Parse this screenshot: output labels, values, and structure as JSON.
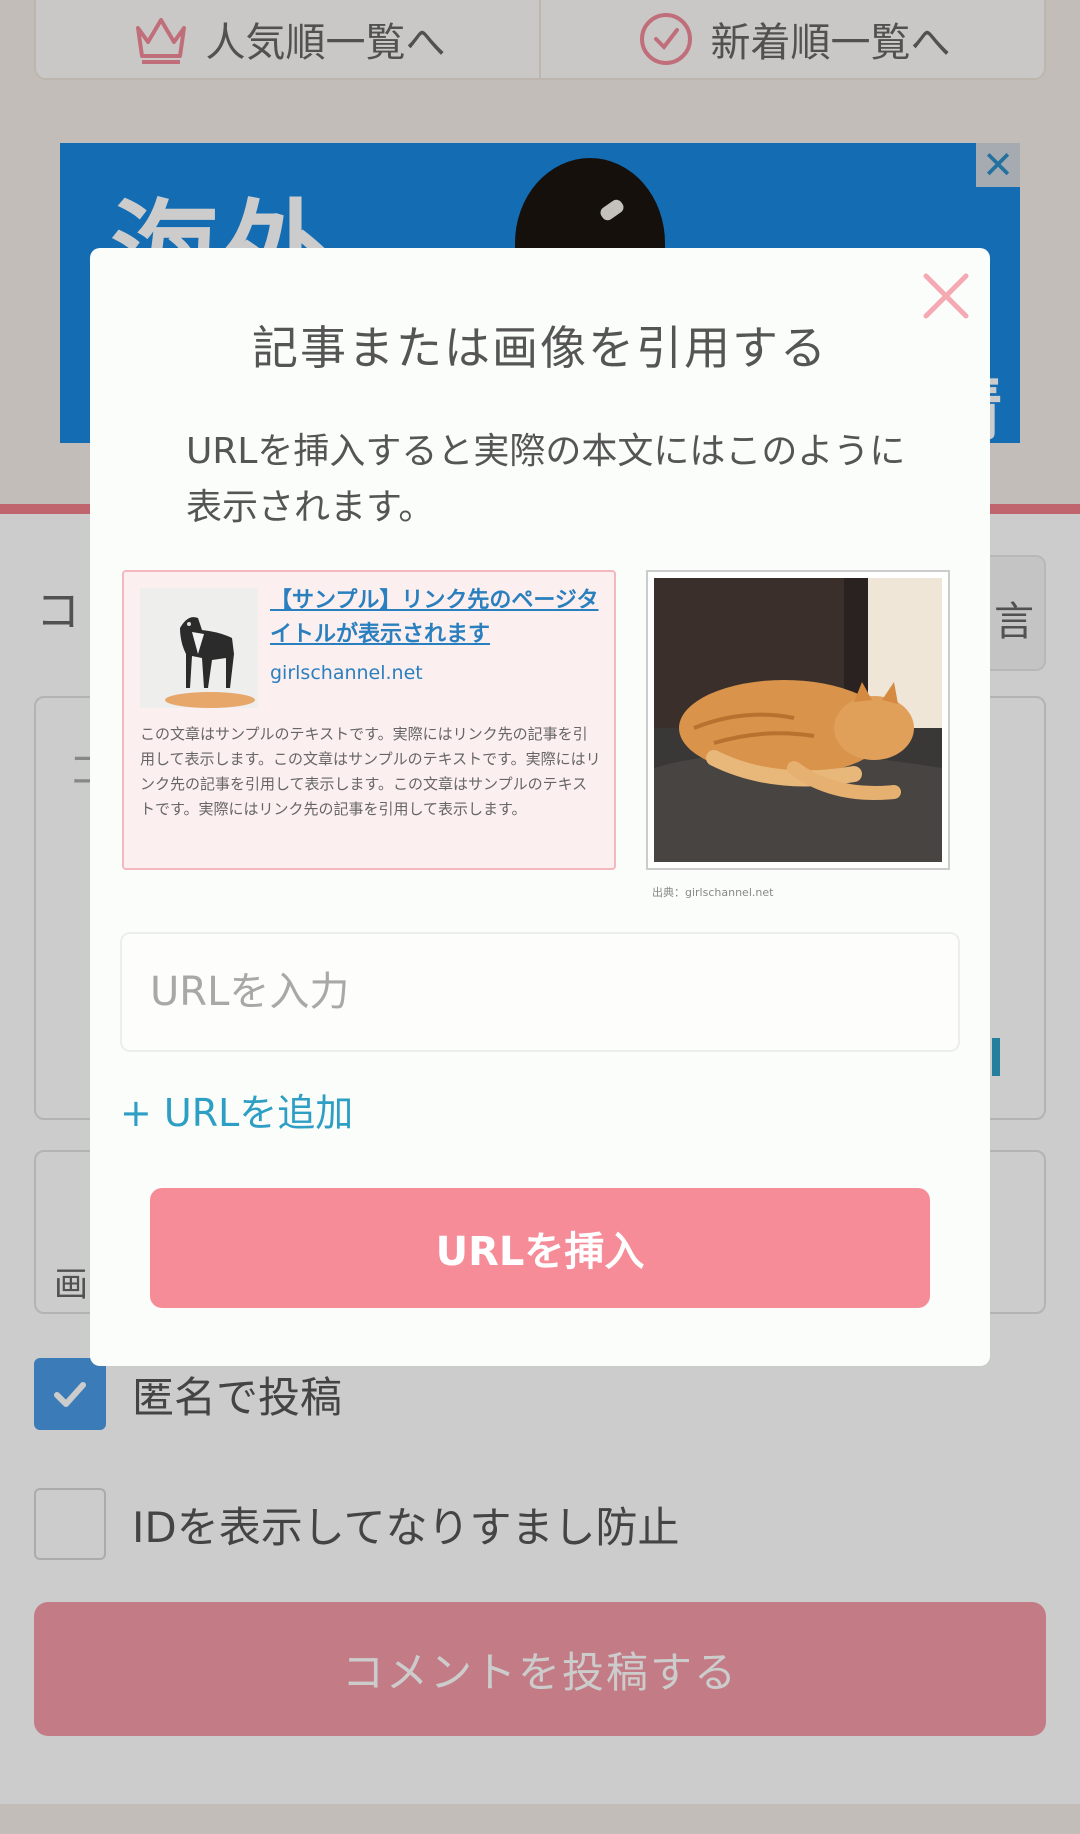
{
  "top_nav": {
    "popular_label": "人気順一覧へ",
    "popular_icon": "crown-icon",
    "newest_label": "新着順一覧へ",
    "newest_icon": "clock-check-icon"
  },
  "ad": {
    "headline": "海外",
    "right_text": "情",
    "close_icon": "close-icon",
    "close_glyph": "✕"
  },
  "form": {
    "left_label_fragment": "コ",
    "right_box_fragment": "言",
    "textarea_fragment": "コ",
    "image_label_fragment": "画",
    "anonymous_label": "匿名で投稿",
    "anonymous_checked": true,
    "show_id_label": "IDを表示してなりすまし防止",
    "show_id_checked": false,
    "submit_label": "コメントを投稿する"
  },
  "modal": {
    "title": "記事または画像を引用する",
    "description": "URLを挿入すると実際の本文にはこのように表示されます。",
    "close_icon": "close-x-icon",
    "sample_link": {
      "title": "【サンプル】リンク先のページタイトルが表示されます",
      "domain": "girlschannel.net",
      "body": "この文章はサンプルのテキストです。実際にはリンク先の記事を引用して表示します。この文章はサンプルのテキストです。実際にはリンク先の記事を引用して表示します。この文章はサンプルのテキストです。実際にはリンク先の記事を引用して表示します。"
    },
    "sample_photo": {
      "caption": "出典：girlschannel.net"
    },
    "url_input_placeholder": "URLを入力",
    "url_input_value": "",
    "add_url_label": "+ URLを追加",
    "insert_button_label": "URLを挿入"
  },
  "colors": {
    "accent_pink": "#f58c98",
    "link_blue": "#2e9fc4",
    "check_blue": "#4a9be6",
    "close_pink": "#f5a9b3"
  }
}
